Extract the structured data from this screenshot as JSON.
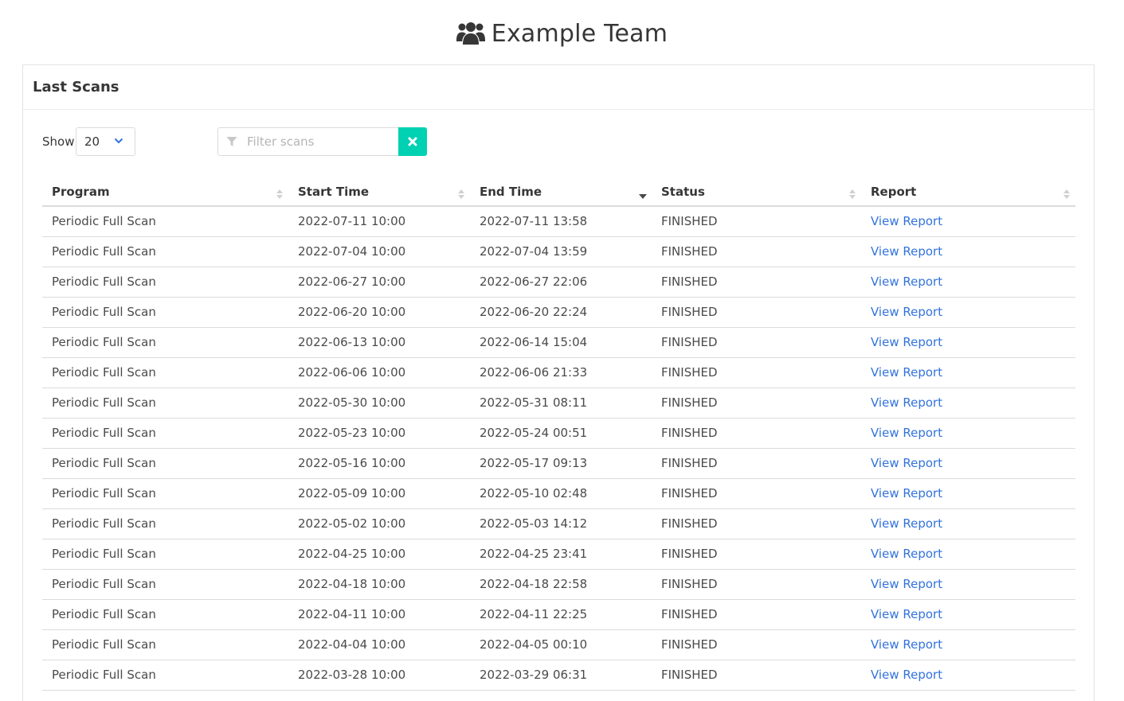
{
  "header": {
    "title": "Example Team",
    "icon": "users-icon"
  },
  "card": {
    "title": "Last Scans"
  },
  "controls": {
    "show_label": "Show",
    "page_size": "20",
    "filter_placeholder": "Filter scans",
    "clear_icon": "close-icon"
  },
  "table": {
    "columns": [
      "Program",
      "Start Time",
      "End Time",
      "Status",
      "Report"
    ],
    "sorted_column": "End Time",
    "sort_direction": "descending",
    "rows": [
      {
        "program": "Periodic Full Scan",
        "start": "2022-07-11 10:00",
        "end": "2022-07-11 13:58",
        "status": "FINISHED",
        "report": "View Report"
      },
      {
        "program": "Periodic Full Scan",
        "start": "2022-07-04 10:00",
        "end": "2022-07-04 13:59",
        "status": "FINISHED",
        "report": "View Report"
      },
      {
        "program": "Periodic Full Scan",
        "start": "2022-06-27 10:00",
        "end": "2022-06-27 22:06",
        "status": "FINISHED",
        "report": "View Report"
      },
      {
        "program": "Periodic Full Scan",
        "start": "2022-06-20 10:00",
        "end": "2022-06-20 22:24",
        "status": "FINISHED",
        "report": "View Report"
      },
      {
        "program": "Periodic Full Scan",
        "start": "2022-06-13 10:00",
        "end": "2022-06-14 15:04",
        "status": "FINISHED",
        "report": "View Report"
      },
      {
        "program": "Periodic Full Scan",
        "start": "2022-06-06 10:00",
        "end": "2022-06-06 21:33",
        "status": "FINISHED",
        "report": "View Report"
      },
      {
        "program": "Periodic Full Scan",
        "start": "2022-05-30 10:00",
        "end": "2022-05-31 08:11",
        "status": "FINISHED",
        "report": "View Report"
      },
      {
        "program": "Periodic Full Scan",
        "start": "2022-05-23 10:00",
        "end": "2022-05-24 00:51",
        "status": "FINISHED",
        "report": "View Report"
      },
      {
        "program": "Periodic Full Scan",
        "start": "2022-05-16 10:00",
        "end": "2022-05-17 09:13",
        "status": "FINISHED",
        "report": "View Report"
      },
      {
        "program": "Periodic Full Scan",
        "start": "2022-05-09 10:00",
        "end": "2022-05-10 02:48",
        "status": "FINISHED",
        "report": "View Report"
      },
      {
        "program": "Periodic Full Scan",
        "start": "2022-05-02 10:00",
        "end": "2022-05-03 14:12",
        "status": "FINISHED",
        "report": "View Report"
      },
      {
        "program": "Periodic Full Scan",
        "start": "2022-04-25 10:00",
        "end": "2022-04-25 23:41",
        "status": "FINISHED",
        "report": "View Report"
      },
      {
        "program": "Periodic Full Scan",
        "start": "2022-04-18 10:00",
        "end": "2022-04-18 22:58",
        "status": "FINISHED",
        "report": "View Report"
      },
      {
        "program": "Periodic Full Scan",
        "start": "2022-04-11 10:00",
        "end": "2022-04-11 22:25",
        "status": "FINISHED",
        "report": "View Report"
      },
      {
        "program": "Periodic Full Scan",
        "start": "2022-04-04 10:00",
        "end": "2022-04-05 00:10",
        "status": "FINISHED",
        "report": "View Report"
      },
      {
        "program": "Periodic Full Scan",
        "start": "2022-03-28 10:00",
        "end": "2022-03-29 06:31",
        "status": "FINISHED",
        "report": "View Report"
      }
    ]
  },
  "colors": {
    "accent": "#00d1b2",
    "link": "#3273dc",
    "text": "#363636"
  }
}
